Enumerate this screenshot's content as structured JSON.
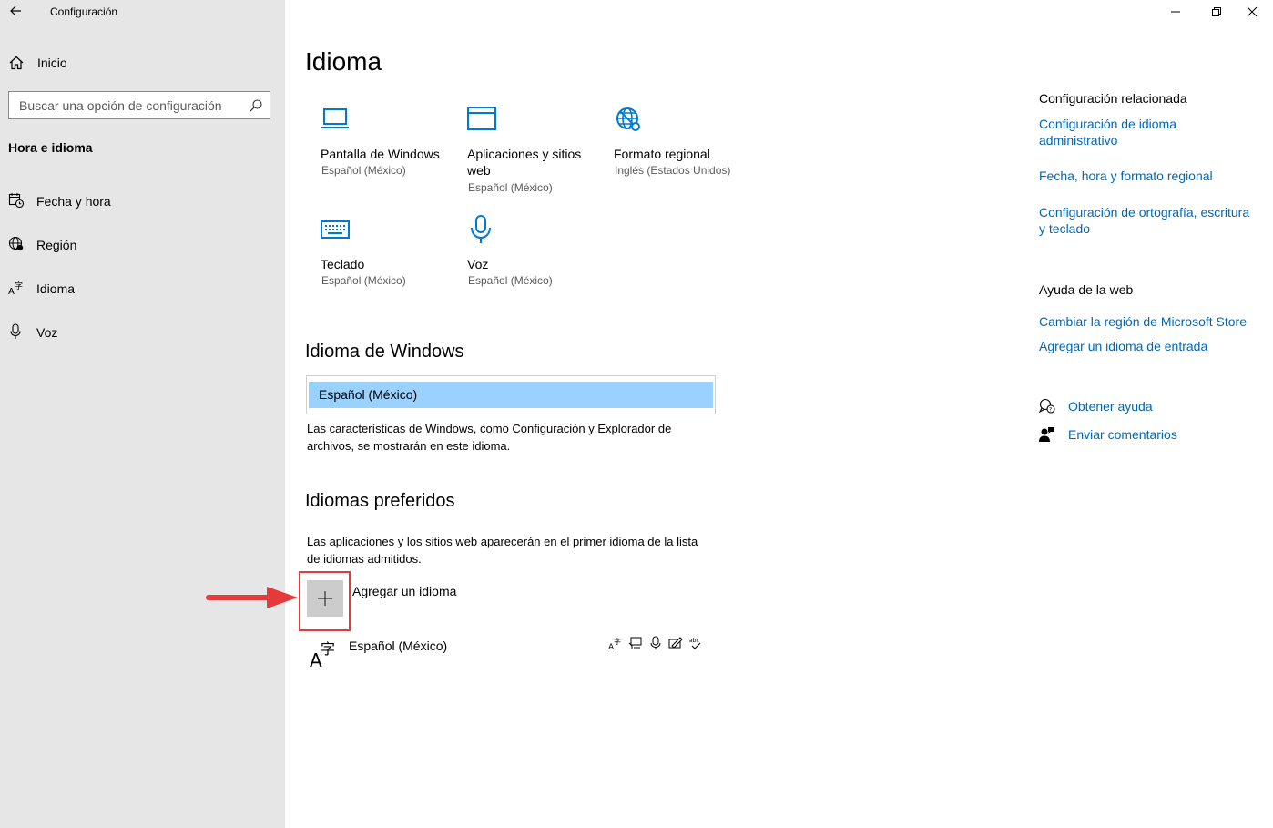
{
  "window": {
    "app_title": "Configuración"
  },
  "sidebar": {
    "home_label": "Inicio",
    "search_placeholder": "Buscar una opción de configuración",
    "section_title": "Hora e idioma",
    "items": [
      {
        "label": "Fecha y hora",
        "icon": "calendar-clock-icon"
      },
      {
        "label": "Región",
        "icon": "globe-region-icon"
      },
      {
        "label": "Idioma",
        "icon": "language-icon"
      },
      {
        "label": "Voz",
        "icon": "microphone-icon"
      }
    ]
  },
  "main": {
    "title": "Idioma",
    "tiles": [
      {
        "name": "Pantalla de Windows",
        "sub": "Español (México)",
        "icon": "laptop-icon"
      },
      {
        "name": "Aplicaciones y sitios web",
        "sub": "Español (México)",
        "icon": "browser-window-icon"
      },
      {
        "name": "Formato regional",
        "sub": "Inglés (Estados Unidos)",
        "icon": "globe-format-icon"
      },
      {
        "name": "Teclado",
        "sub": "Español (México)",
        "icon": "keyboard-icon"
      },
      {
        "name": "Voz",
        "sub": "Español (México)",
        "icon": "microphone-icon"
      }
    ],
    "windows_language": {
      "heading": "Idioma de Windows",
      "selected": "Español (México)",
      "description": "Las características de Windows, como Configuración y Explorador de archivos, se mostrarán en este idioma."
    },
    "preferred": {
      "heading": "Idiomas preferidos",
      "description": "Las aplicaciones y los sitios web aparecerán en el primer idioma de la lista de idiomas admitidos.",
      "add_label": "Agregar un idioma",
      "languages": [
        {
          "label": "Español (México)"
        }
      ]
    }
  },
  "right": {
    "related_heading": "Configuración relacionada",
    "related_links": [
      "Configuración de idioma administrativo",
      "Fecha, hora y formato regional",
      "Configuración de ortografía, escritura y teclado"
    ],
    "web_help_heading": "Ayuda de la web",
    "web_links": [
      "Cambiar la región de Microsoft Store",
      "Agregar un idioma de entrada"
    ],
    "get_help": "Obtener ayuda",
    "feedback": "Enviar comentarios"
  },
  "colors": {
    "accent": "#0067b8",
    "icon_blue": "#0078d7",
    "selection": "#99d1ff",
    "highlight": "#e5393a"
  }
}
